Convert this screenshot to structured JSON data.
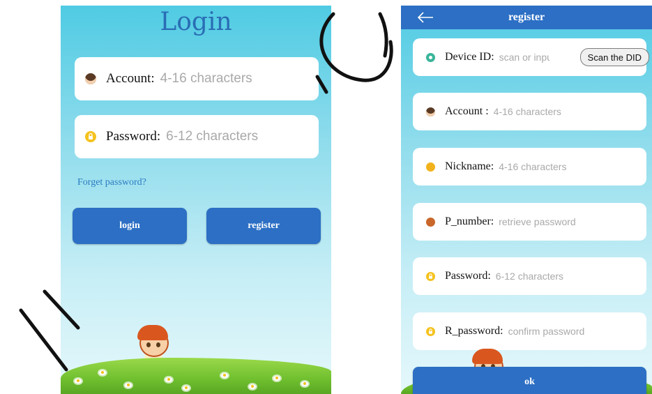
{
  "login": {
    "title": "Login",
    "account": {
      "label": "Account:",
      "placeholder": "4-16 characters",
      "icon": "avatar-icon"
    },
    "password": {
      "label": "Password:",
      "placeholder": "6-12 characters",
      "icon": "lock-icon"
    },
    "forget_link": "Forget password?",
    "login_button": "login",
    "register_button": "register"
  },
  "register": {
    "title": "register",
    "device": {
      "label": "Device ID:",
      "placeholder": "scan or input",
      "scan_button": "Scan the DID",
      "icon": "location-pin-icon"
    },
    "account": {
      "label": "Account :",
      "placeholder": "4-16 characters",
      "icon": "avatar-icon"
    },
    "nickname": {
      "label": "Nickname:",
      "placeholder": "4-16 characters",
      "icon": "nickname-icon"
    },
    "p_number": {
      "label": "P_number:",
      "placeholder": "retrieve password",
      "icon": "phone-icon"
    },
    "password": {
      "label": "Password:",
      "placeholder": "6-12 characters",
      "icon": "lock-icon"
    },
    "r_password": {
      "label": "R_password:",
      "placeholder": "confirm password",
      "icon": "lock-icon"
    },
    "ok_button": "ok"
  },
  "colors": {
    "accent_blue": "#2c6fc4",
    "sky_top": "#4fcbe3",
    "lock_yellow": "#f5c21e",
    "pin_green": "#3bb59a"
  }
}
